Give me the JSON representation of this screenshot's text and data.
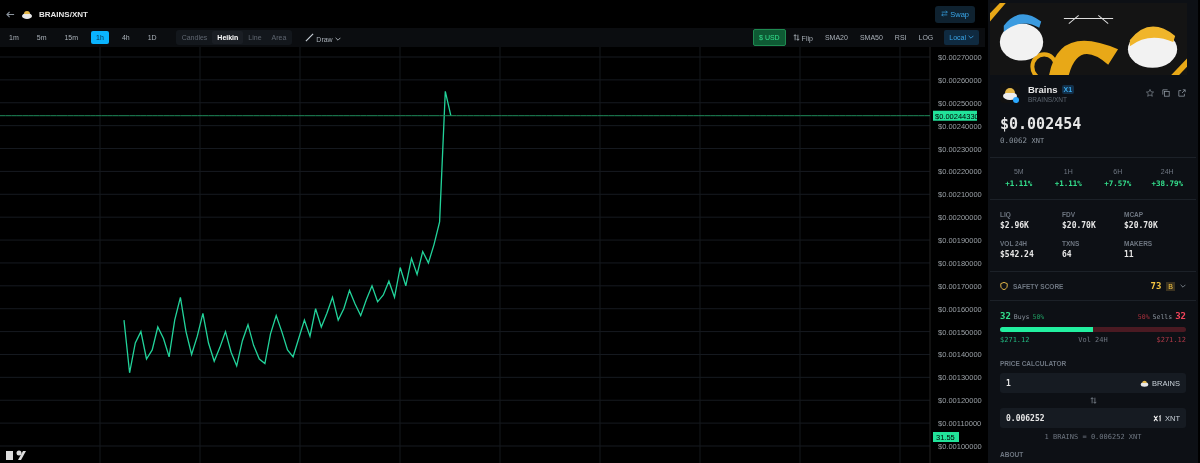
{
  "header": {
    "pair": "BRAINS/XNT",
    "swap_button": "Swap"
  },
  "toolbar": {
    "intervals": [
      {
        "label": "1m",
        "selected": false
      },
      {
        "label": "5m",
        "selected": false
      },
      {
        "label": "15m",
        "selected": false
      },
      {
        "label": "1h",
        "selected": true
      },
      {
        "label": "4h",
        "selected": false
      },
      {
        "label": "1D",
        "selected": false
      }
    ],
    "chart_styles": [
      {
        "label": "Candles",
        "selected": false
      },
      {
        "label": "Heikin",
        "selected": true
      },
      {
        "label": "Line",
        "selected": false
      },
      {
        "label": "Area",
        "selected": false
      }
    ],
    "draw": "Draw",
    "currency": {
      "label": "$ USD",
      "on": true
    },
    "flip": "Flip",
    "indicators": [
      "SMA20",
      "SMA50",
      "RSI",
      "LOG"
    ],
    "timezone": "Local"
  },
  "chart": {
    "price_tag": "$0.00244330",
    "volume_tag": "31.55",
    "chart_data": {
      "type": "line",
      "ylim": [
        0.001,
        0.0027
      ],
      "grid": true,
      "yticks": [
        {
          "value": 0.0027,
          "label": "$0.00270000"
        },
        {
          "value": 0.0026,
          "label": "$0.00260000"
        },
        {
          "value": 0.0025,
          "label": "$0.00250000"
        },
        {
          "value": 0.0024,
          "label": "$0.00240000"
        },
        {
          "value": 0.0023,
          "label": "$0.00230000"
        },
        {
          "value": 0.0022,
          "label": "$0.00220000"
        },
        {
          "value": 0.0021,
          "label": "$0.00210000"
        },
        {
          "value": 0.002,
          "label": "$0.00200000"
        },
        {
          "value": 0.0019,
          "label": "$0.00190000"
        },
        {
          "value": 0.0018,
          "label": "$0.00180000"
        },
        {
          "value": 0.0017,
          "label": "$0.00170000"
        },
        {
          "value": 0.0016,
          "label": "$0.00160000"
        },
        {
          "value": 0.0015,
          "label": "$0.00150000"
        },
        {
          "value": 0.0014,
          "label": "$0.00140000"
        },
        {
          "value": 0.0013,
          "label": "$0.00130000"
        },
        {
          "value": 0.0012,
          "label": "$0.00120000"
        },
        {
          "value": 0.0011,
          "label": "$0.00110000"
        },
        {
          "value": 0.001,
          "label": "$0.00100000"
        }
      ],
      "series": [
        {
          "color": "#22d39a",
          "values": [
            null,
            null,
            null,
            null,
            null,
            null,
            null,
            null,
            null,
            null,
            null,
            null,
            null,
            null,
            null,
            null,
            null,
            null,
            null,
            null,
            null,
            null,
            0.00155,
            0.00132,
            0.00145,
            0.0015,
            0.00138,
            0.00142,
            0.00152,
            0.00147,
            0.00139,
            0.00155,
            0.00165,
            0.0015,
            0.0014,
            0.00148,
            0.00158,
            0.00145,
            0.00137,
            0.00143,
            0.0015,
            0.00141,
            0.00135,
            0.00146,
            0.00153,
            0.00144,
            0.00138,
            0.00136,
            0.00149,
            0.00157,
            0.0015,
            0.00142,
            0.00139,
            0.00147,
            0.00155,
            0.00148,
            0.0016,
            0.00152,
            0.00158,
            0.00165,
            0.00155,
            0.0016,
            0.00168,
            0.00162,
            0.00157,
            0.00164,
            0.0017,
            0.00163,
            0.00166,
            0.00172,
            0.00165,
            0.00178,
            0.0017,
            0.00182,
            0.00175,
            0.00185,
            0.0018,
            0.00188,
            0.00198,
            0.00255,
            0.002443,
            null,
            null,
            null,
            null,
            null,
            null,
            null,
            null,
            null,
            null,
            null,
            null,
            null,
            null,
            null,
            null,
            null,
            null,
            null,
            null,
            null,
            null,
            null,
            null,
            null,
            null,
            null,
            null,
            null,
            null,
            null,
            null,
            null,
            null,
            null,
            null,
            null,
            null,
            null,
            null,
            null,
            null,
            null,
            null,
            null,
            null,
            null,
            null,
            null,
            null,
            null,
            null,
            null,
            null,
            null,
            null,
            null,
            null,
            null,
            null,
            null,
            null,
            null,
            null,
            null,
            null,
            null,
            null,
            null,
            null,
            null,
            null,
            null,
            null,
            null,
            null,
            null,
            null,
            null,
            null,
            null
          ]
        },
        {
          "color": "#1f8a5a",
          "values": [
            0.0024433,
            0.0024433,
            0.0024433,
            0.0024433,
            0.0024433,
            0.0024433,
            0.0024433,
            0.0024433,
            0.0024433,
            0.0024433,
            0.0024433,
            0.0024433,
            0.0024433,
            0.0024433,
            0.0024433,
            0.0024433,
            0.0024433,
            0.0024433,
            0.0024433,
            0.0024433,
            0.0024433,
            0.0024433,
            0.0024433,
            0.0024433,
            0.0024433,
            0.0024433,
            0.0024433,
            0.0024433,
            0.0024433,
            0.0024433,
            0.0024433,
            0.0024433,
            0.0024433,
            0.0024433,
            0.0024433,
            0.0024433,
            0.0024433,
            0.0024433,
            0.0024433,
            0.0024433,
            0.0024433,
            0.0024433,
            0.0024433,
            0.0024433,
            0.0024433,
            0.0024433,
            0.0024433,
            0.0024433,
            0.0024433,
            0.0024433,
            0.0024433,
            0.0024433,
            0.0024433,
            0.0024433,
            0.0024433,
            0.0024433,
            0.0024433,
            0.0024433,
            0.0024433,
            0.0024433,
            0.0024433,
            0.0024433,
            0.0024433,
            0.0024433,
            0.0024433,
            0.0024433,
            0.0024433,
            0.0024433,
            0.0024433,
            0.0024433,
            0.0024433,
            0.0024433,
            0.0024433,
            0.0024433,
            0.0024433,
            0.0024433,
            0.0024433,
            0.0024433,
            0.0024433,
            0.0024433,
            0.0024433,
            0.0024433,
            0.0024433,
            0.0024433,
            0.0024433,
            0.0024433,
            0.0024433,
            0.0024433,
            0.0024433,
            0.0024433,
            0.0024433,
            0.0024433,
            0.0024433,
            0.0024433,
            0.0024433,
            0.0024433,
            0.0024433,
            0.0024433,
            0.0024433,
            0.0024433,
            0.0024433,
            0.0024433,
            0.0024433,
            0.0024433,
            0.0024433,
            0.0024433,
            0.0024433,
            0.0024433,
            0.0024433,
            0.0024433,
            0.0024433,
            0.0024433,
            0.0024433,
            0.0024433,
            0.0024433,
            0.0024433,
            0.0024433,
            0.0024433,
            0.0024433,
            0.0024433,
            0.0024433,
            0.0024433,
            0.0024433,
            0.0024433,
            0.0024433,
            0.0024433,
            0.0024433,
            0.0024433,
            0.0024433,
            0.0024433,
            0.0024433,
            0.0024433,
            0.0024433,
            0.0024433,
            0.0024433,
            0.0024433,
            0.0024433,
            0.0024433,
            0.0024433,
            0.0024433,
            0.0024433,
            0.0024433,
            0.0024433,
            0.0024433,
            0.0024433,
            0.0024433,
            0.0024433,
            0.0024433,
            0.0024433,
            0.0024433,
            0.0024433,
            0.0024433,
            0.0024433,
            0.0024433,
            0.0024433,
            0.0024433,
            0.0024433,
            0.0024433,
            0.0024433,
            0.0024433,
            0.0024433,
            0.0024433,
            0.0024433,
            0.0024433,
            0.0024433,
            0.0024433
          ]
        }
      ]
    }
  },
  "token": {
    "name": "Brains",
    "chain_badge": "X1",
    "pair": "BRAINS/XNT",
    "price_usd": "$0.002454",
    "price_native": "0.0062",
    "native_symbol": "XNT",
    "changes": [
      {
        "period": "5M",
        "value": "+1.11%"
      },
      {
        "period": "1H",
        "value": "+1.11%"
      },
      {
        "period": "6H",
        "value": "+7.57%"
      },
      {
        "period": "24H",
        "value": "+38.79%"
      }
    ],
    "stats": [
      {
        "label": "LIQ",
        "value": "$2.96K"
      },
      {
        "label": "FDV",
        "value": "$20.70K"
      },
      {
        "label": "MCAP",
        "value": "$20.70K"
      },
      {
        "label": "VOL 24H",
        "value": "$542.24"
      },
      {
        "label": "TXNS",
        "value": "64"
      },
      {
        "label": "MAKERS",
        "value": "11"
      }
    ],
    "safety": {
      "label": "SAFETY SCORE",
      "score": "73",
      "grade": "B"
    },
    "trades": {
      "buys_count": "32",
      "buys_label": "Buys",
      "buys_pct": "50%",
      "sells_pct": "50%",
      "sells_label": "Sells",
      "sells_count": "32",
      "level": 0.5,
      "buy_volume": "$271.12",
      "volume_label": "Vol 24H",
      "sell_volume": "$271.12"
    },
    "calculator": {
      "title": "PRICE CALCULATOR",
      "amount": "1",
      "token_symbol": "BRAINS",
      "converted": "0.006252",
      "native_symbol": "XNT",
      "rate": "1 BRAINS = 0.006252 XNT"
    },
    "about": "ABOUT"
  }
}
